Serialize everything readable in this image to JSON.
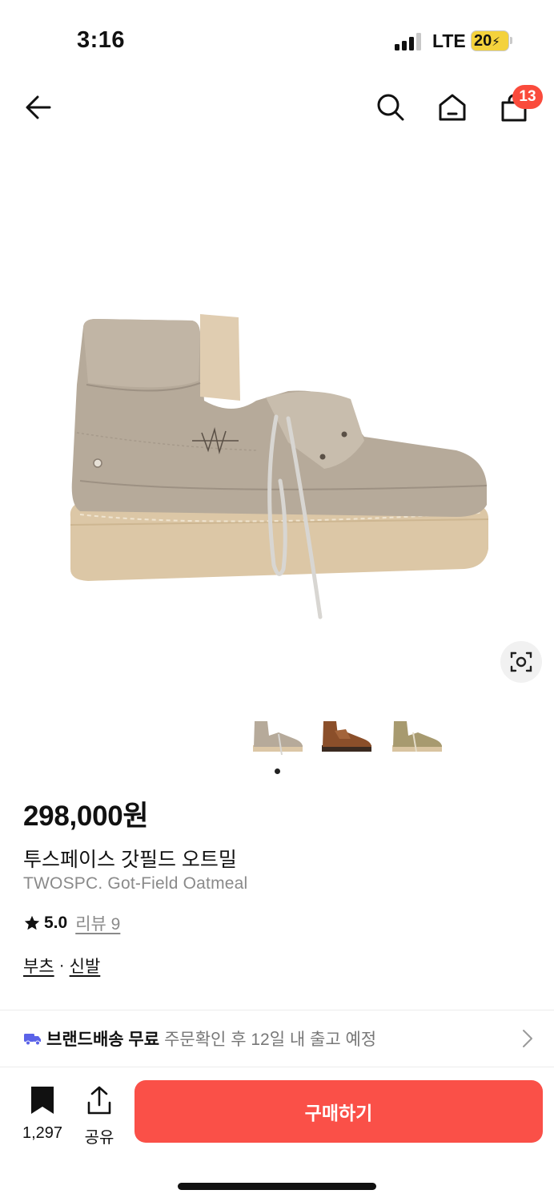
{
  "status_bar": {
    "time": "3:16",
    "network": "LTE",
    "battery": "20"
  },
  "nav": {
    "back_icon": "arrow-left-icon",
    "search_icon": "search-icon",
    "home_icon": "home-icon",
    "cart_icon": "shopping-bag-icon",
    "cart_count": "13"
  },
  "gallery": {
    "lens_icon": "image-search-icon",
    "thumbnails": [
      "oatmeal",
      "brown",
      "olive"
    ],
    "current_page": 1
  },
  "product": {
    "price": "298,000원",
    "name_ko": "투스페이스 갓필드 오트밀",
    "name_en": "TWOSPC. Got-Field Oatmeal",
    "rating": "5.0",
    "review_label": "리뷰 9",
    "category_1": "부츠",
    "category_sep": "·",
    "category_2": "신발"
  },
  "shipping": {
    "icon": "truck-icon",
    "strong": "브랜드배송 무료",
    "note": "주문확인 후 12일 내 출고 예정"
  },
  "bottom_bar": {
    "bookmark_count": "1,297",
    "share_label": "공유",
    "buy_label": "구매하기"
  },
  "colors": {
    "accent": "#fa5048",
    "badge": "#fa4b3c",
    "shipping_icon": "#5b63e8",
    "battery": "#f4d23c"
  }
}
